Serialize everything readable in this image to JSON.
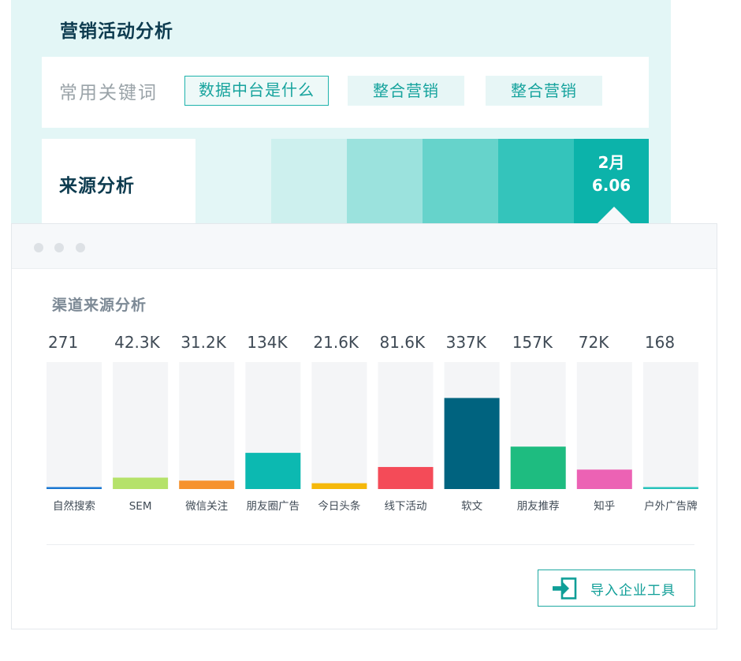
{
  "header": {
    "title": "营销活动分析"
  },
  "keywords": {
    "label": "常用关键词",
    "tags": [
      "数据中台是什么",
      "整合营销",
      "整合营销"
    ]
  },
  "source": {
    "label": "来源分析",
    "segment_colors": [
      "#cdf0ee",
      "#9be2dd",
      "#66d3cb",
      "#34c4bb",
      "#0cb3aa"
    ],
    "highlight": {
      "month": "2月",
      "value": "6.06"
    }
  },
  "window": {
    "chart_title": "渠道来源分析",
    "import_button_label": "导入企业工具",
    "accent_color": "#1fa9a2"
  },
  "chart_data": {
    "type": "bar",
    "categories": [
      "自然搜索",
      "SEM",
      "微信关注",
      "朋友圈广告",
      "今日头条",
      "线下活动",
      "软文",
      "朋友推荐",
      "知乎",
      "户外广告牌"
    ],
    "value_labels": [
      "271",
      "42.3K",
      "31.2K",
      "134K",
      "21.6K",
      "81.6K",
      "337K",
      "157K",
      "72K",
      "168"
    ],
    "values": [
      271,
      42300,
      31200,
      134000,
      21600,
      81600,
      337000,
      157000,
      72000,
      168
    ],
    "colors": [
      "#1976d2",
      "#b5e26a",
      "#f6922d",
      "#0cb9b1",
      "#f5b80a",
      "#f44b58",
      "#00637f",
      "#1ebc80",
      "#ec62b4",
      "#27c2bb"
    ],
    "ylim": [
      0,
      470000
    ],
    "grid": false,
    "legend": "none"
  }
}
